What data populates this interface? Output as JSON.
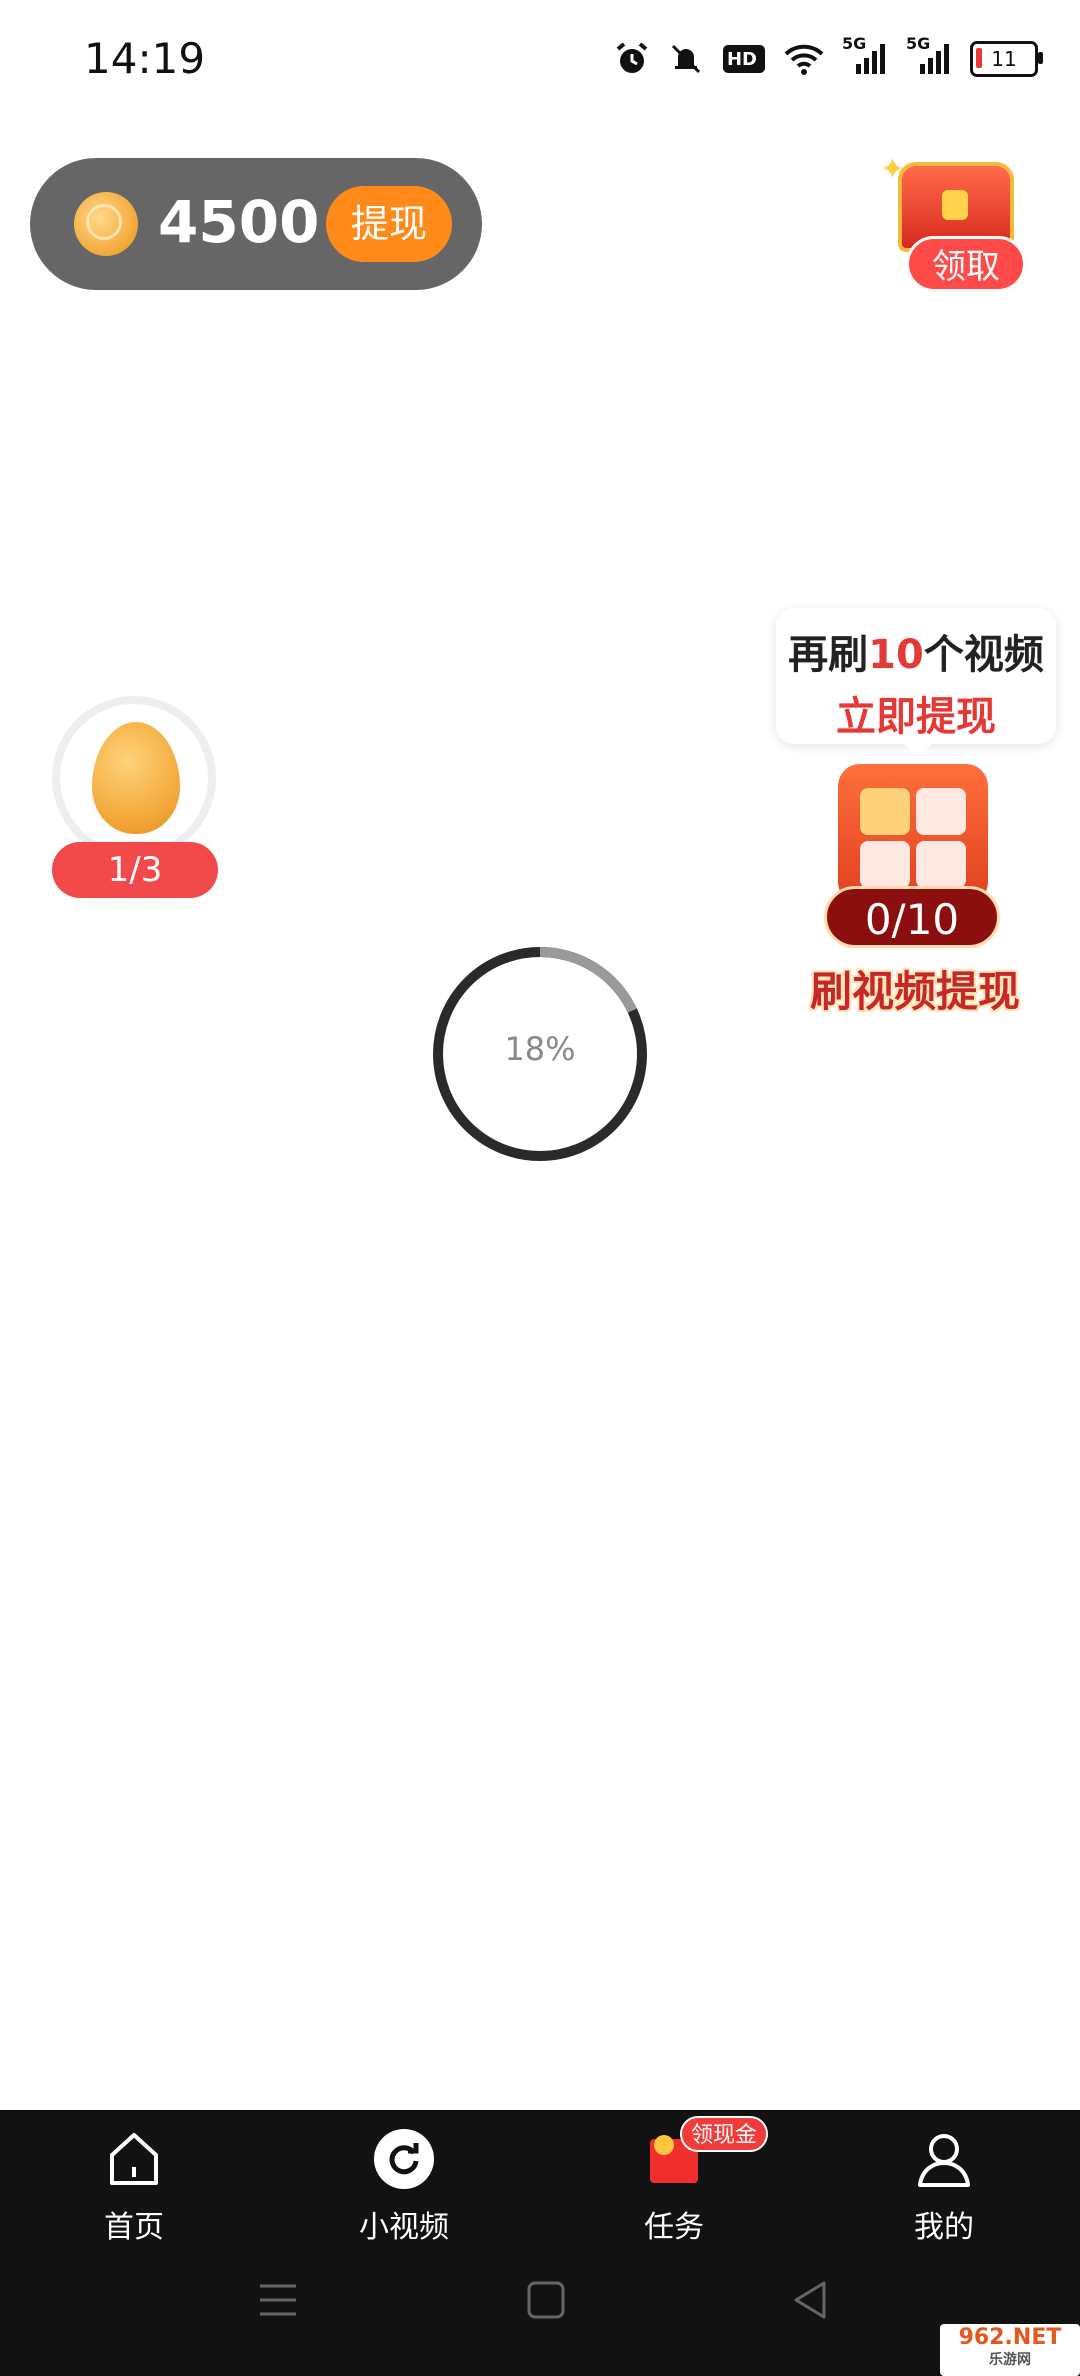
{
  "status_bar": {
    "time": "14:19",
    "battery_level": "11",
    "icons": [
      "alarm-icon",
      "mute-icon",
      "hd-icon",
      "wifi-icon",
      "signal-5g-icon",
      "signal-5g-icon",
      "battery-icon"
    ],
    "hd_label": "HD",
    "net1": "5G",
    "net2": "5G"
  },
  "wallet": {
    "coins": "4500",
    "withdraw_label": "提现"
  },
  "chest": {
    "claim_label": "领取"
  },
  "egg": {
    "progress": "1/3"
  },
  "video_task": {
    "bubble_prefix": "再刷",
    "bubble_count": "10",
    "bubble_suffix": "个视频",
    "bubble_line2": "立即提现",
    "counter": "0/10",
    "label": "刷视频提现"
  },
  "loading": {
    "percent_text": "18%",
    "progress": 0.18
  },
  "bottom_nav": {
    "items": [
      {
        "label": "首页",
        "icon": "home-icon"
      },
      {
        "label": "小视频",
        "icon": "video-refresh-icon"
      },
      {
        "label": "任务",
        "icon": "task-envelope-icon"
      },
      {
        "label": "我的",
        "icon": "profile-icon"
      }
    ],
    "task_badge": "领现金"
  },
  "watermark": {
    "main": "962.NET",
    "sub": "乐游网"
  },
  "colors": {
    "accent_orange": "#ff8a1a",
    "red": "#f24a4a",
    "nav_bg": "#121212"
  }
}
